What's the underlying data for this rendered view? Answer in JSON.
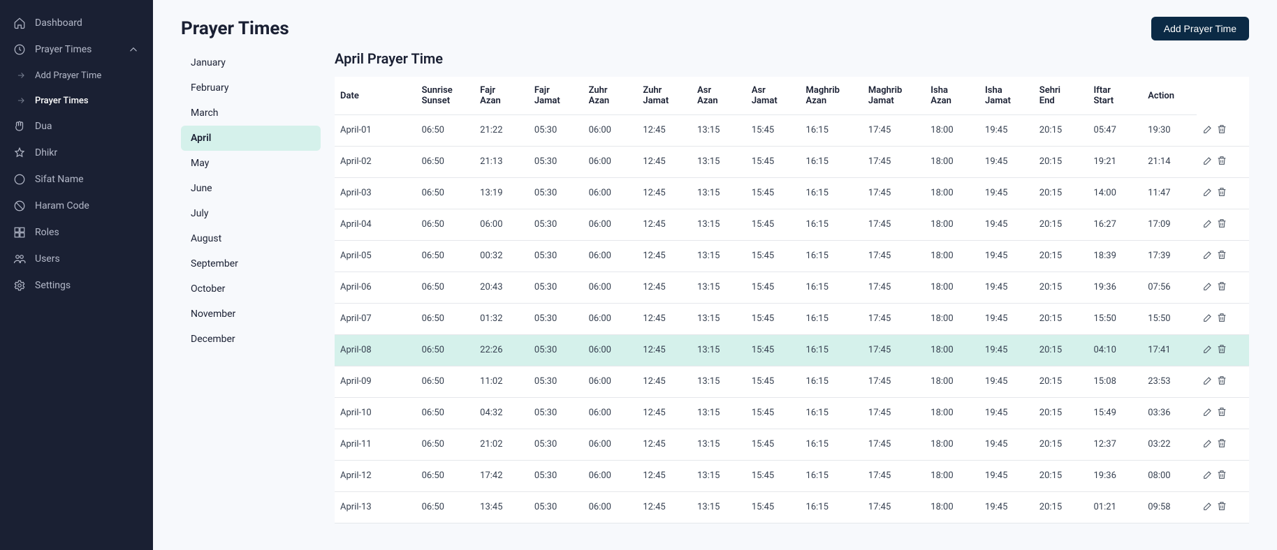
{
  "sidebar": {
    "items": [
      {
        "icon": "home",
        "label": "Dashboard",
        "interactable": true
      },
      {
        "icon": "clock",
        "label": "Prayer Times",
        "interactable": true,
        "expanded": true,
        "children": [
          {
            "label": "Add Prayer Time",
            "interactable": true
          },
          {
            "label": "Prayer Times",
            "interactable": true,
            "active": true
          }
        ]
      },
      {
        "icon": "hands",
        "label": "Dua",
        "interactable": true
      },
      {
        "icon": "star",
        "label": "Dhikr",
        "interactable": true
      },
      {
        "icon": "circle",
        "label": "Sifat Name",
        "interactable": true
      },
      {
        "icon": "ban",
        "label": "Haram Code",
        "interactable": true
      },
      {
        "icon": "grid",
        "label": "Roles",
        "interactable": true
      },
      {
        "icon": "users",
        "label": "Users",
        "interactable": true
      },
      {
        "icon": "gear",
        "label": "Settings",
        "interactable": true
      }
    ]
  },
  "page": {
    "title": "Prayer Times",
    "add_button": "Add Prayer Time",
    "subtitle": "April Prayer Time"
  },
  "months": [
    "January",
    "February",
    "March",
    "April",
    "May",
    "June",
    "July",
    "August",
    "September",
    "October",
    "November",
    "December"
  ],
  "active_month": "April",
  "table": {
    "columns": [
      {
        "l1": "Date"
      },
      {
        "l1": "Sunrise",
        "l2": "Sunset"
      },
      {
        "l1": "Fajr",
        "l2": "Azan"
      },
      {
        "l1": "Fajr",
        "l2": "Jamat"
      },
      {
        "l1": "Zuhr",
        "l2": "Azan"
      },
      {
        "l1": "Zuhr",
        "l2": "Jamat"
      },
      {
        "l1": "Asr",
        "l2": "Azan"
      },
      {
        "l1": "Asr",
        "l2": "Jamat"
      },
      {
        "l1": "Maghrib",
        "l2": "Azan"
      },
      {
        "l1": "Maghrib",
        "l2": "Jamat"
      },
      {
        "l1": "Isha",
        "l2": "Azan"
      },
      {
        "l1": "Isha",
        "l2": "Jamat"
      },
      {
        "l1": "Sehri",
        "l2": "End"
      },
      {
        "l1": "Iftar",
        "l2": "Start"
      },
      {
        "l1": "Action"
      }
    ],
    "rows": [
      {
        "date": "April-01",
        "cells": [
          "06:50",
          "21:22",
          "05:30",
          "06:00",
          "12:45",
          "13:15",
          "15:45",
          "16:15",
          "17:45",
          "18:00",
          "19:45",
          "20:15",
          "05:47",
          "19:30"
        ]
      },
      {
        "date": "April-02",
        "cells": [
          "06:50",
          "21:13",
          "05:30",
          "06:00",
          "12:45",
          "13:15",
          "15:45",
          "16:15",
          "17:45",
          "18:00",
          "19:45",
          "20:15",
          "19:21",
          "21:14"
        ]
      },
      {
        "date": "April-03",
        "cells": [
          "06:50",
          "13:19",
          "05:30",
          "06:00",
          "12:45",
          "13:15",
          "15:45",
          "16:15",
          "17:45",
          "18:00",
          "19:45",
          "20:15",
          "14:00",
          "11:47"
        ]
      },
      {
        "date": "April-04",
        "cells": [
          "06:50",
          "06:00",
          "05:30",
          "06:00",
          "12:45",
          "13:15",
          "15:45",
          "16:15",
          "17:45",
          "18:00",
          "19:45",
          "20:15",
          "16:27",
          "17:09"
        ]
      },
      {
        "date": "April-05",
        "cells": [
          "06:50",
          "00:32",
          "05:30",
          "06:00",
          "12:45",
          "13:15",
          "15:45",
          "16:15",
          "17:45",
          "18:00",
          "19:45",
          "20:15",
          "18:39",
          "17:39"
        ]
      },
      {
        "date": "April-06",
        "cells": [
          "06:50",
          "20:43",
          "05:30",
          "06:00",
          "12:45",
          "13:15",
          "15:45",
          "16:15",
          "17:45",
          "18:00",
          "19:45",
          "20:15",
          "19:36",
          "07:56"
        ]
      },
      {
        "date": "April-07",
        "cells": [
          "06:50",
          "01:32",
          "05:30",
          "06:00",
          "12:45",
          "13:15",
          "15:45",
          "16:15",
          "17:45",
          "18:00",
          "19:45",
          "20:15",
          "15:50",
          "15:50"
        ]
      },
      {
        "date": "April-08",
        "cells": [
          "06:50",
          "22:26",
          "05:30",
          "06:00",
          "12:45",
          "13:15",
          "15:45",
          "16:15",
          "17:45",
          "18:00",
          "19:45",
          "20:15",
          "04:10",
          "17:41"
        ],
        "highlight": true
      },
      {
        "date": "April-09",
        "cells": [
          "06:50",
          "11:02",
          "05:30",
          "06:00",
          "12:45",
          "13:15",
          "15:45",
          "16:15",
          "17:45",
          "18:00",
          "19:45",
          "20:15",
          "15:08",
          "23:53"
        ]
      },
      {
        "date": "April-10",
        "cells": [
          "06:50",
          "04:32",
          "05:30",
          "06:00",
          "12:45",
          "13:15",
          "15:45",
          "16:15",
          "17:45",
          "18:00",
          "19:45",
          "20:15",
          "15:49",
          "03:36"
        ]
      },
      {
        "date": "April-11",
        "cells": [
          "06:50",
          "21:02",
          "05:30",
          "06:00",
          "12:45",
          "13:15",
          "15:45",
          "16:15",
          "17:45",
          "18:00",
          "19:45",
          "20:15",
          "12:37",
          "03:22"
        ]
      },
      {
        "date": "April-12",
        "cells": [
          "06:50",
          "17:42",
          "05:30",
          "06:00",
          "12:45",
          "13:15",
          "15:45",
          "16:15",
          "17:45",
          "18:00",
          "19:45",
          "20:15",
          "19:36",
          "08:00"
        ]
      },
      {
        "date": "April-13",
        "cells": [
          "06:50",
          "13:45",
          "05:30",
          "06:00",
          "12:45",
          "13:15",
          "15:45",
          "16:15",
          "17:45",
          "18:00",
          "19:45",
          "20:15",
          "01:21",
          "09:58"
        ]
      }
    ]
  }
}
